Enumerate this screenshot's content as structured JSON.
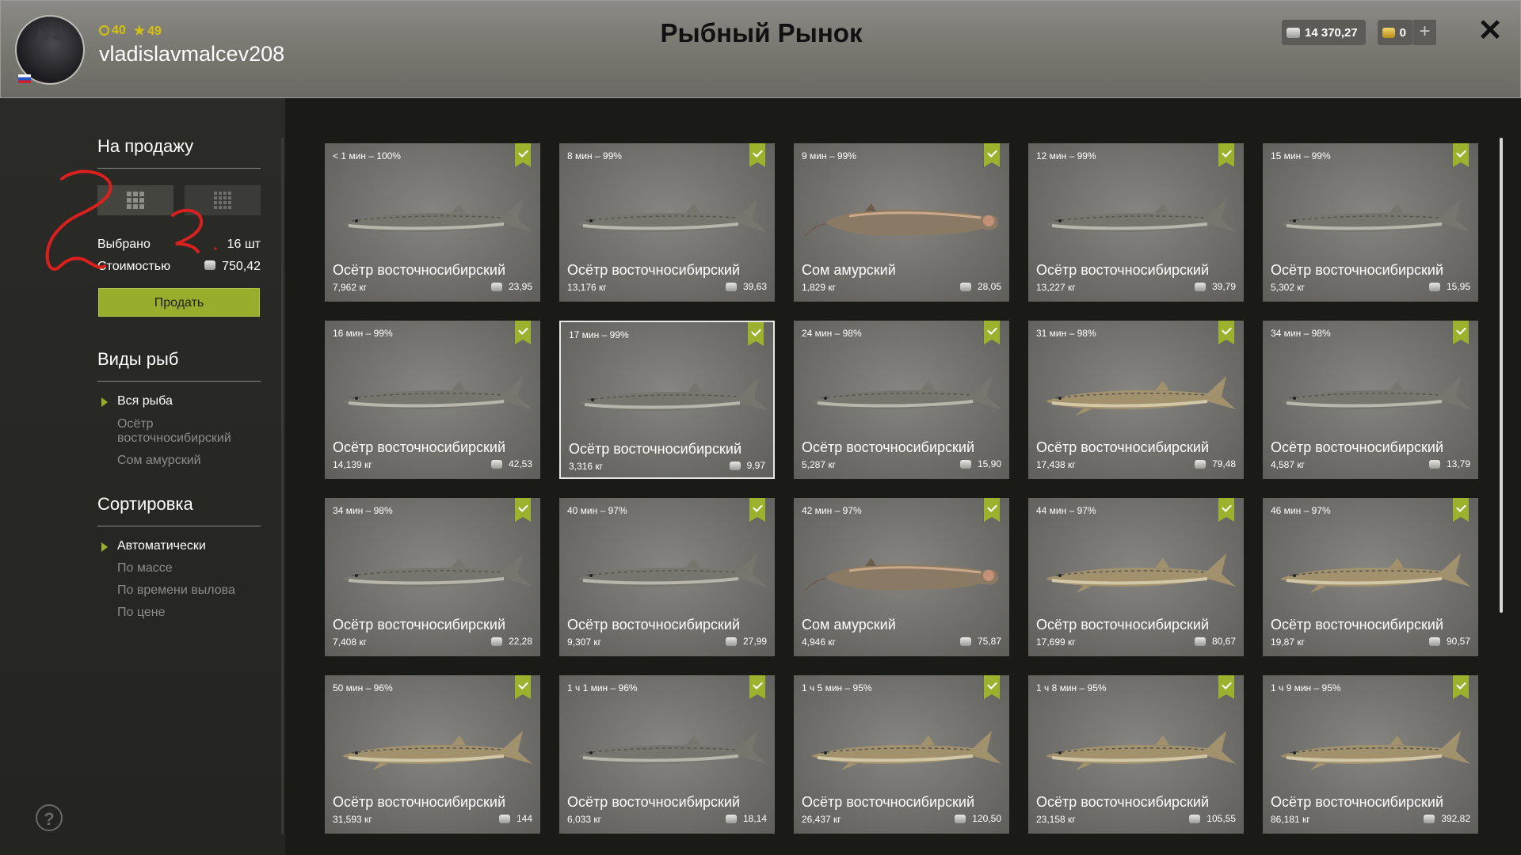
{
  "header": {
    "level": "40",
    "rank": "49",
    "username": "vladislavmalcev208",
    "title": "Рыбный Рынок",
    "silver": "14 370,27",
    "gold": "0",
    "plus": "+",
    "close": "✕"
  },
  "sidebar": {
    "for_sale_title": "На продажу",
    "selected_label": "Выбрано",
    "selected_value": "16 шт",
    "cost_label": "Стоимостью",
    "cost_value": "750,42",
    "sell_button": "Продать",
    "species_title": "Виды рыб",
    "species": [
      "Вся рыба",
      "Осётр восточносибирский",
      "Сом амурский"
    ],
    "sort_title": "Сортировка",
    "sort": [
      "Автоматически",
      "По массе",
      "По времени вылова",
      "По цене"
    ],
    "help": "?"
  },
  "colors": {
    "accent": "#99ad2c",
    "badge": "#9cb22f",
    "scribble": "#d8201e"
  },
  "cards": [
    {
      "time": "< 1 мин – 100%",
      "name": "Осётр восточносибирский",
      "weight": "7,962 кг",
      "price": "23,95",
      "fish": "sturgeon-dark"
    },
    {
      "time": "8 мин – 99%",
      "name": "Осётр восточносибирский",
      "weight": "13,176 кг",
      "price": "39,63",
      "fish": "sturgeon-dark"
    },
    {
      "time": "9 мин – 99%",
      "name": "Сом амурский",
      "weight": "1,829 кг",
      "price": "28,05",
      "fish": "catfish"
    },
    {
      "time": "12 мин – 99%",
      "name": "Осётр восточносибирский",
      "weight": "13,227 кг",
      "price": "39,79",
      "fish": "sturgeon-dark"
    },
    {
      "time": "15 мин – 99%",
      "name": "Осётр восточносибирский",
      "weight": "5,302 кг",
      "price": "15,95",
      "fish": "sturgeon-dark"
    },
    {
      "time": "16 мин – 99%",
      "name": "Осётр восточносибирский",
      "weight": "14,139 кг",
      "price": "42,53",
      "fish": "sturgeon-dark"
    },
    {
      "time": "17 мин – 99%",
      "name": "Осётр восточносибирский",
      "weight": "3,316 кг",
      "price": "9,97",
      "fish": "sturgeon-dark",
      "selected": true
    },
    {
      "time": "24 мин – 98%",
      "name": "Осётр восточносибирский",
      "weight": "5,287 кг",
      "price": "15,90",
      "fish": "sturgeon-dark"
    },
    {
      "time": "31 мин – 98%",
      "name": "Осётр восточносибирский",
      "weight": "17,438 кг",
      "price": "79,48",
      "fish": "sturgeon-light"
    },
    {
      "time": "34 мин – 98%",
      "name": "Осётр восточносибирский",
      "weight": "4,587 кг",
      "price": "13,79",
      "fish": "sturgeon-dark"
    },
    {
      "time": "34 мин – 98%",
      "name": "Осётр восточносибирский",
      "weight": "7,408 кг",
      "price": "22,28",
      "fish": "sturgeon-dark"
    },
    {
      "time": "40 мин – 97%",
      "name": "Осётр восточносибирский",
      "weight": "9,307 кг",
      "price": "27,99",
      "fish": "sturgeon-dark"
    },
    {
      "time": "42 мин – 97%",
      "name": "Сом амурский",
      "weight": "4,946 кг",
      "price": "75,87",
      "fish": "catfish"
    },
    {
      "time": "44 мин – 97%",
      "name": "Осётр восточносибирский",
      "weight": "17,699 кг",
      "price": "80,67",
      "fish": "sturgeon-light"
    },
    {
      "time": "46 мин – 97%",
      "name": "Осётр восточносибирский",
      "weight": "19,87 кг",
      "price": "90,57",
      "fish": "sturgeon-light"
    },
    {
      "time": "50 мин – 96%",
      "name": "Осётр восточносибирский",
      "weight": "31,593 кг",
      "price": "144",
      "fish": "sturgeon-light"
    },
    {
      "time": "1 ч 1 мин – 96%",
      "name": "Осётр восточносибирский",
      "weight": "6,033 кг",
      "price": "18,14",
      "fish": "sturgeon-dark"
    },
    {
      "time": "1 ч 5 мин – 95%",
      "name": "Осётр восточносибирский",
      "weight": "26,437 кг",
      "price": "120,50",
      "fish": "sturgeon-light"
    },
    {
      "time": "1 ч 8 мин – 95%",
      "name": "Осётр восточносибирский",
      "weight": "23,158 кг",
      "price": "105,55",
      "fish": "sturgeon-light"
    },
    {
      "time": "1 ч 9 мин – 95%",
      "name": "Осётр восточносибирский",
      "weight": "86,181 кг",
      "price": "392,82",
      "fish": "sturgeon-light"
    }
  ]
}
